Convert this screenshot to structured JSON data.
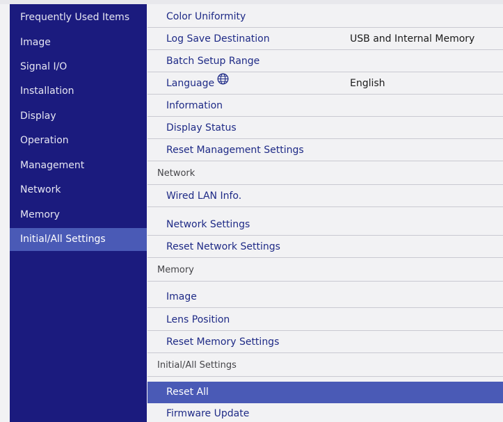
{
  "sidebar": {
    "items": [
      {
        "label": "Frequently Used Items"
      },
      {
        "label": "Image"
      },
      {
        "label": "Signal I/O"
      },
      {
        "label": "Installation"
      },
      {
        "label": "Display"
      },
      {
        "label": "Operation"
      },
      {
        "label": "Management"
      },
      {
        "label": "Network"
      },
      {
        "label": "Memory"
      },
      {
        "label": "Initial/All Settings",
        "active": true
      }
    ]
  },
  "main": {
    "management_rows": [
      {
        "label": "Color Uniformity",
        "value": ""
      },
      {
        "label": "Log Save Destination",
        "value": "USB and Internal Memory"
      },
      {
        "label": "Batch Setup Range",
        "value": ""
      },
      {
        "label": "Language",
        "value": "English",
        "icon": "globe-icon"
      },
      {
        "label": "Information",
        "value": ""
      },
      {
        "label": "Display Status",
        "value": ""
      },
      {
        "label": "Reset Management Settings",
        "value": ""
      }
    ],
    "network_header": "Network",
    "network_rows": [
      {
        "label": "Wired LAN Info."
      },
      {
        "label": "Network Settings"
      },
      {
        "label": "Reset Network Settings"
      }
    ],
    "memory_header": "Memory",
    "memory_rows": [
      {
        "label": "Image"
      },
      {
        "label": "Lens Position"
      },
      {
        "label": "Reset Memory Settings"
      }
    ],
    "initial_header": "Initial/All Settings",
    "initial_rows": [
      {
        "label": "Reset All",
        "selected": true
      },
      {
        "label": "Firmware Update"
      }
    ]
  },
  "colors": {
    "sidebar_bg": "#1b1b7e",
    "highlight": "#4a5ab6",
    "item_text": "#1e2a86",
    "panel_bg": "#f2f2f4"
  }
}
